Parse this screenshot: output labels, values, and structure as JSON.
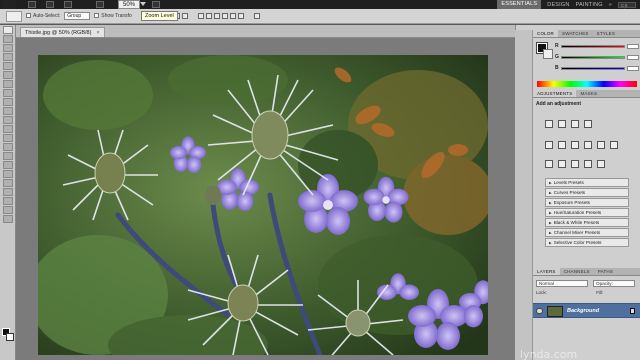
{
  "appbar": {
    "zoom": "50%",
    "workspaces": [
      "ESSENTIALS",
      "DESIGN",
      "PAINTING"
    ],
    "active_workspace": "ESSENTIALS",
    "search": "CS Live"
  },
  "tooltip": "Zoom Level",
  "options_bar": {
    "auto_select_label": "Auto-Select:",
    "auto_select_value": "Group",
    "show_transform_label": "Show Transfo"
  },
  "document": {
    "tab_title": "Thistle.jpg @ 50% (RGB/8)",
    "close": "×"
  },
  "color_panel": {
    "tabs": [
      "COLOR",
      "SWATCHES",
      "STYLES"
    ],
    "channels": [
      "R",
      "G",
      "B"
    ]
  },
  "adjustments_panel": {
    "tabs": [
      "ADJUSTMENTS",
      "MASKS"
    ],
    "title": "Add an adjustment",
    "presets": [
      "Levels Presets",
      "Curves Presets",
      "Exposure Presets",
      "Hue/Saturation Presets",
      "Black & White Presets",
      "Channel Mixer Presets",
      "Selective Color Presets"
    ]
  },
  "layers_panel": {
    "tabs": [
      "LAYERS",
      "CHANNELS",
      "PATHS"
    ],
    "blend_mode": "Normal",
    "opacity": "Opacity:",
    "lock": "Lock:",
    "fill": "Fill:",
    "layer_name": "Background"
  },
  "watermark": "lynda.com",
  "colors": {
    "accent": "#4f6f9e",
    "canvas_gray": "#7b7b7b",
    "panel": "#cfcfcf"
  }
}
